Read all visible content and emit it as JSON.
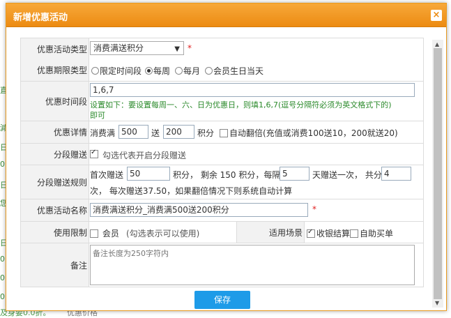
{
  "background": {
    "left_chars": [
      "直",
      "減",
      "日",
      "0",
      "日",
      "您",
      "日",
      "0",
      "0",
      "0"
    ],
    "bottom_left": "及身要0.0折。",
    "bottom_mid": "优惠价格"
  },
  "dialog": {
    "title": "新增优惠活动",
    "close_label": "×"
  },
  "form": {
    "type": {
      "label": "优惠活动类型",
      "value": "消费满送积分",
      "required": "*"
    },
    "period_type": {
      "label": "优惠期限类型",
      "options": [
        "限定时间段",
        "每周",
        "每月",
        "会员生日当天"
      ],
      "selected_index": 1
    },
    "time": {
      "label": "优惠时间段",
      "value": "1,6,7",
      "hint_line1": "设置如下：要设置每周一、六、日为优惠日，则填1,6,7(逗号分隔符必须为英文格式下的)",
      "hint_line2": "即可"
    },
    "detail": {
      "label": "优惠详情",
      "prefix": "消费满",
      "amount": "500",
      "mid": "送",
      "points": "200",
      "suffix": "积分",
      "auto_double_label": "自动翻倍(充值或消费100送10，200就送20)",
      "auto_double_checked": false
    },
    "segmented": {
      "label": "分段赠送",
      "checked": true,
      "hint": "勾选代表开启分段赠送"
    },
    "segment_rule": {
      "label": "分段赠送规则",
      "first_label": "首次赠送",
      "first_value": "50",
      "remain_text": "积分， 剩余 150 积分，每隔",
      "interval_value": "5",
      "interval_text": "天赠送一次， 共分",
      "count_value": "4",
      "line2": "次， 每次赠送37.50，如果翻倍情况下则系统自动计算"
    },
    "name": {
      "label": "优惠活动名称",
      "value": "消费满送积分_消费满500送200积分",
      "required": "*"
    },
    "limit": {
      "label": "使用限制",
      "member_label": "会员",
      "member_hint": "(勾选表示可以使用)",
      "member_checked": false,
      "scene_label": "适用场景",
      "scene_options": [
        {
          "label": "收银结算",
          "checked": true
        },
        {
          "label": "自助买单",
          "checked": false
        }
      ]
    },
    "note": {
      "label": "备注",
      "placeholder": "备注长度为250字符内"
    },
    "save_label": "保存"
  }
}
